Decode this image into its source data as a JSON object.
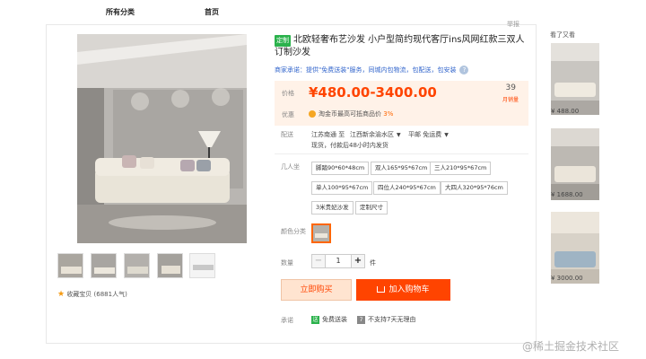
{
  "nav": {
    "all_categories": "所有分类",
    "home": "首页"
  },
  "report": "举报",
  "product": {
    "tag": "定制",
    "title": "北欧轻奢布艺沙发 小户型简约现代客厅ins风网红款三双人订制沙发",
    "promise": "商家承诺：提供\"免费送装\"服务，同城内包物流，包配送，包安装",
    "price_label": "价格",
    "price": "¥480.00-3400.00",
    "sales_count": "39",
    "sales_label": "月销量",
    "discount_label": "优惠",
    "discount_text": "淘金币最高可抵商品价",
    "discount_pct": "3%",
    "ship_label": "配送",
    "ship_from": "江苏南通 至",
    "ship_to": "江西新余渝水区",
    "ship_method": "平邮 免运费",
    "ship_note": "现货，付款后48小时内发货",
    "spec_label": "几人坐",
    "specs": [
      "脚踏90*60*48cm",
      "双人165*95*67cm",
      "三人210*95*67cm",
      "单人100*95*67cm",
      "四位人240*95*67cm",
      "大四人320*95*76cm",
      "3米贵妃沙发",
      "定制尺寸"
    ],
    "color_label": "颜色分类",
    "qty_label": "数量",
    "qty_value": "1",
    "qty_unit": "件",
    "buy_now": "立即购买",
    "add_cart": "加入购物车",
    "commit_label": "承诺",
    "commit_free": "免费送装",
    "commit_no_return": "不支持7天无理由",
    "favorite": "收藏宝贝 (6881人气)",
    "accent": "#ff4400"
  },
  "sidebar": {
    "title": "看了又看",
    "items": [
      {
        "price": "¥ 488.00"
      },
      {
        "price": "¥ 1688.00"
      },
      {
        "price": "¥ 3000.00"
      }
    ]
  },
  "watermark": "@稀土掘金技术社区"
}
